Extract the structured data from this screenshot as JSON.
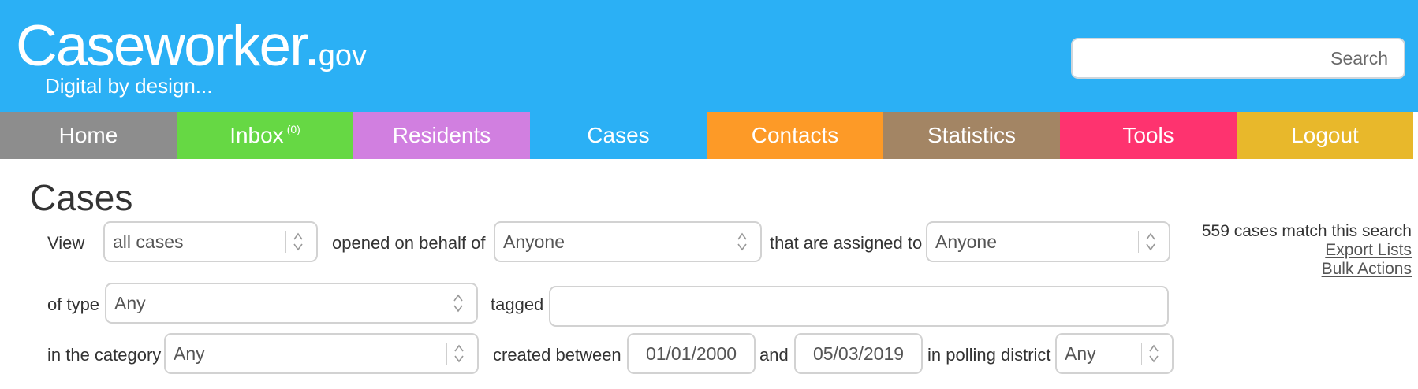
{
  "header": {
    "brand_name": "Caseworker.",
    "brand_tld": "gov",
    "tagline": "Digital by design...",
    "search_placeholder": "Search"
  },
  "nav": {
    "items": [
      {
        "label": "Home",
        "color": "#8d8d8d"
      },
      {
        "label": "Inbox",
        "badge": "(0)",
        "color": "#66d844"
      },
      {
        "label": "Residents",
        "color": "#d17fe0"
      },
      {
        "label": "Cases",
        "color": "#2bb0f5"
      },
      {
        "label": "Contacts",
        "color": "#fd9a27"
      },
      {
        "label": "Statistics",
        "color": "#a38564"
      },
      {
        "label": "Tools",
        "color": "#fe336f"
      },
      {
        "label": "Logout",
        "color": "#e8b82b"
      }
    ]
  },
  "main": {
    "title": "Cases",
    "filters": {
      "view_label": "View",
      "view_value": "all cases",
      "behalf_label": "opened on behalf of",
      "behalf_value": "Anyone",
      "assigned_label": "that are assigned to",
      "assigned_value": "Anyone",
      "type_label": "of type",
      "type_value": "Any",
      "tagged_label": "tagged",
      "tagged_value": "",
      "category_label": "in the category",
      "category_value": "Any",
      "created_label": "created between",
      "date_from": "01/01/2000",
      "and_label": "and",
      "date_to": "05/03/2019",
      "district_label": "in polling district",
      "district_value": "Any"
    },
    "results": {
      "count_text": "559 cases match this search",
      "export_link": "Export Lists",
      "bulk_link": "Bulk Actions"
    }
  }
}
